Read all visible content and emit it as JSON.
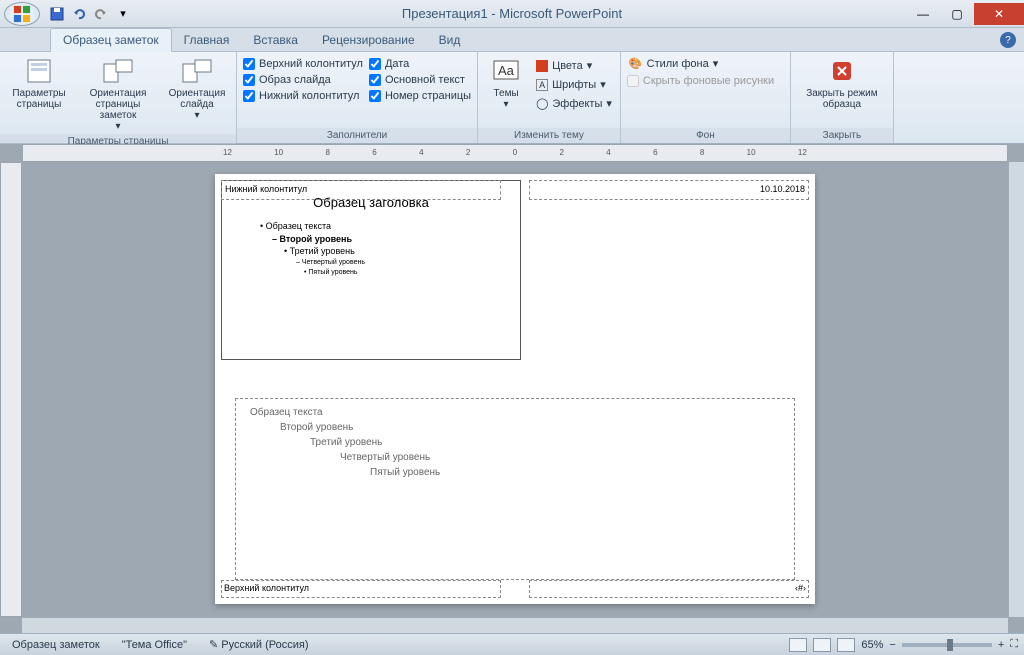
{
  "title": "Презентация1 - Microsoft PowerPoint",
  "tabs": {
    "active": "Образец заметок",
    "items": [
      "Главная",
      "Вставка",
      "Рецензирование",
      "Вид"
    ]
  },
  "ribbon": {
    "group1": {
      "label": "Параметры страницы",
      "btn1": "Параметры страницы",
      "btn2": "Ориентация страницы заметок",
      "btn3": "Ориентация слайда"
    },
    "group2": {
      "label": "Заполнители",
      "chk1": "Верхний колонтитул",
      "chk2": "Образ слайда",
      "chk3": "Нижний колонтитул",
      "chk4": "Дата",
      "chk5": "Основной текст",
      "chk6": "Номер страницы"
    },
    "group3": {
      "label": "Изменить тему",
      "themes": "Темы",
      "colors": "Цвета",
      "fonts": "Шрифты",
      "effects": "Эффекты"
    },
    "group4": {
      "label": "Фон",
      "styles": "Стили фона",
      "hide": "Скрыть фоновые рисунки"
    },
    "group5": {
      "label": "Закрыть",
      "close": "Закрыть режим образца"
    }
  },
  "page": {
    "header_left": "Нижний колонтитул",
    "header_right": "10.10.2018",
    "slide_title": "Образец заголовка",
    "slide_l1": "• Образец текста",
    "slide_l2": "– Второй уровень",
    "slide_l3": "• Третий уровень",
    "slide_l4": "– Четвертый уровень",
    "slide_l5": "• Пятый уровень",
    "notes_l1": "Образец текста",
    "notes_l2": "Второй уровень",
    "notes_l3": "Третий уровень",
    "notes_l4": "Четвертый уровень",
    "notes_l5": "Пятый уровень",
    "footer_left": "Верхний колонтитул",
    "footer_right": "‹#›"
  },
  "status": {
    "mode": "Образец заметок",
    "theme": "\"Тема Office\"",
    "lang": "Русский (Россия)",
    "zoom": "65%"
  },
  "ruler_ticks": [
    "12",
    "10",
    "8",
    "6",
    "4",
    "2",
    "0",
    "2",
    "4",
    "6",
    "8",
    "10",
    "12"
  ]
}
